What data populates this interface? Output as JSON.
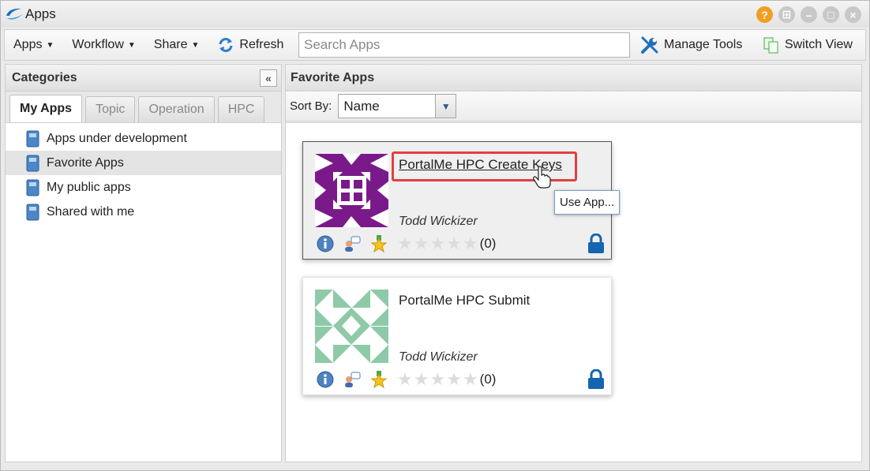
{
  "window": {
    "title": "Apps"
  },
  "toolbar": {
    "apps_label": "Apps",
    "workflow_label": "Workflow",
    "share_label": "Share",
    "refresh_label": "Refresh",
    "search_placeholder": "Search Apps",
    "manage_tools_label": "Manage Tools",
    "switch_view_label": "Switch View"
  },
  "categories": {
    "title": "Categories",
    "tabs": [
      {
        "label": "My Apps"
      },
      {
        "label": "Topic"
      },
      {
        "label": "Operation"
      },
      {
        "label": "HPC"
      }
    ],
    "items": [
      {
        "label": "Apps under development"
      },
      {
        "label": "Favorite Apps"
      },
      {
        "label": "My public apps"
      },
      {
        "label": "Shared with me"
      }
    ]
  },
  "main": {
    "title": "Favorite Apps",
    "sort_label": "Sort By:",
    "sort_value": "Name",
    "apps": [
      {
        "name": "PortalMe HPC Create Keys",
        "author": "Todd Wickizer",
        "rating_count": "(0)"
      },
      {
        "name": "PortalMe HPC Submit",
        "author": "Todd Wickizer",
        "rating_count": "(0)"
      }
    ],
    "tooltip": "Use App..."
  },
  "colors": {
    "accent_red": "#e04040",
    "thumb_purple": "#7a1a8a",
    "thumb_green": "#8fcaa8",
    "lock_blue": "#1565b0"
  }
}
